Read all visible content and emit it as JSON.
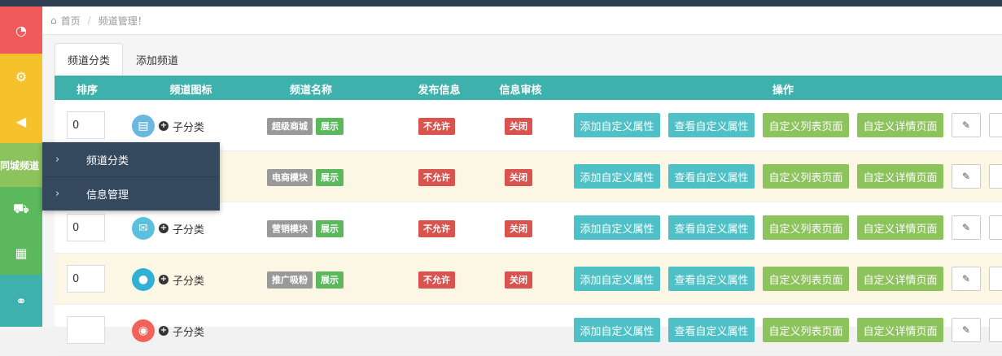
{
  "breadcrumb": {
    "home": "首页",
    "current": "频道管理！"
  },
  "leftbar": {
    "items": [
      {
        "icon": "dashboard-icon",
        "glyph": "◔",
        "color": "#f15a5a"
      },
      {
        "icon": "gear-icon",
        "glyph": "⚙",
        "color": "#f6c22b"
      },
      {
        "icon": "volume-icon",
        "glyph": "◀",
        "color": "#f6c22b"
      },
      {
        "label": "同城频道",
        "color": "#8dc35d"
      },
      {
        "icon": "cart-icon",
        "glyph": "⛟",
        "color": "#5cb85c"
      },
      {
        "icon": "table-icon",
        "glyph": "▦",
        "color": "#5cb85c"
      },
      {
        "icon": "link-icon",
        "glyph": "⚭",
        "color": "#3fb1ad"
      }
    ]
  },
  "tabs": [
    {
      "label": "频道分类"
    },
    {
      "label": "添加频道"
    }
  ],
  "table": {
    "headers": [
      "排序",
      "频道图标",
      "频道名称",
      "发布信息",
      "信息审核",
      "操作"
    ],
    "rows": [
      {
        "sort": "0",
        "icon": "store-icon",
        "icon_color": "#6ab7e0",
        "sub": "子分类",
        "name": "超级商城",
        "status": "展示",
        "publish": "不允许",
        "audit": "关闭"
      },
      {
        "sort": "",
        "icon": "",
        "icon_color": "",
        "sub": "",
        "name": "电商模块",
        "status": "展示",
        "publish": "不允许",
        "audit": "关闭"
      },
      {
        "sort": "0",
        "icon": "chat-icon",
        "icon_color": "#5bc0de",
        "sub": "子分类",
        "name": "营销模块",
        "status": "展示",
        "publish": "不允许",
        "audit": "关闭"
      },
      {
        "sort": "0",
        "icon": "bubbles-icon",
        "icon_color": "#31b0d5",
        "sub": "子分类",
        "name": "推广吸粉",
        "status": "展示",
        "publish": "不允许",
        "audit": "关闭"
      },
      {
        "sort": "",
        "icon": "circle-icon",
        "icon_color": "#f0625a",
        "sub": "子分类",
        "name": "",
        "status": "",
        "publish": "",
        "audit": ""
      }
    ],
    "actions": {
      "add_attr": "添加自定义属性",
      "view_attr": "查看自定义属性",
      "list_page": "自定义列表页面",
      "detail_page": "自定义详情页面",
      "edit": "✎"
    }
  },
  "dropdown": {
    "items": [
      {
        "label": "频道分类"
      },
      {
        "label": "信息管理"
      }
    ]
  }
}
